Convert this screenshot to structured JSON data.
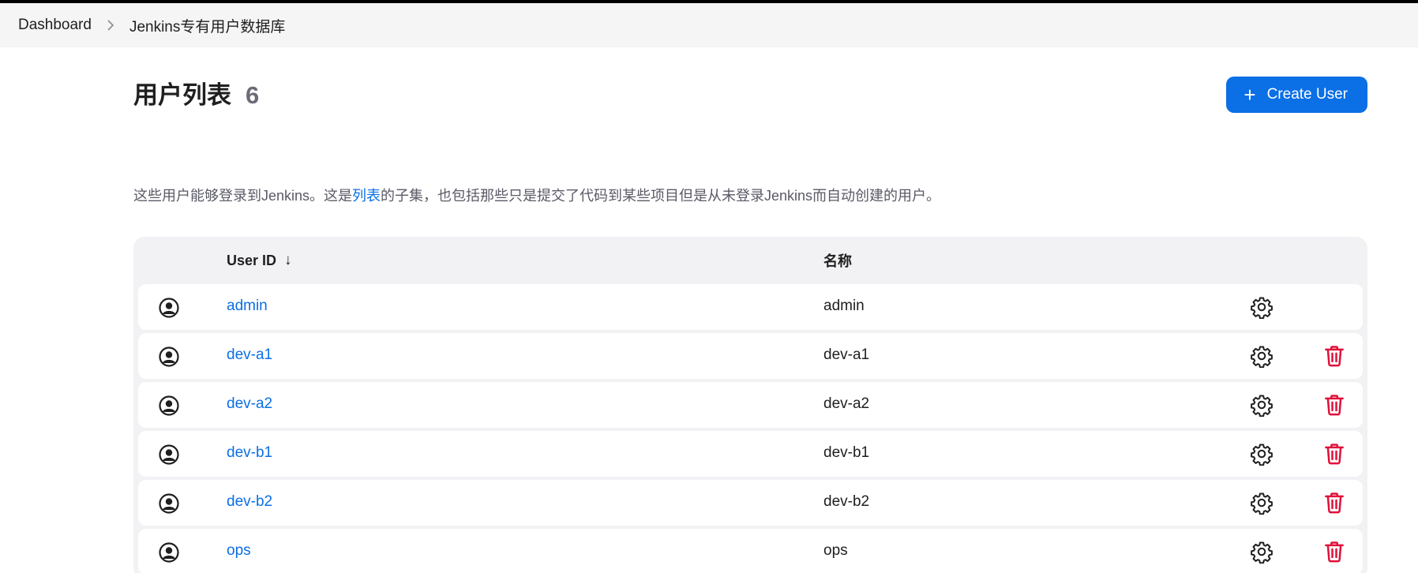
{
  "breadcrumb": {
    "items": [
      {
        "label": "Dashboard"
      },
      {
        "label": "Jenkins专有用户数据库"
      }
    ]
  },
  "header": {
    "title": "用户列表",
    "count": "6",
    "create_button_label": "Create User"
  },
  "description": {
    "before_link": "这些用户能够登录到Jenkins。这是",
    "link_text": "列表",
    "after_link": "的子集，也包括那些只是提交了代码到某些项目但是从未登录Jenkins而自动创建的用户。"
  },
  "table": {
    "columns": {
      "user_id": "User ID",
      "sort_indicator": "↓",
      "name": "名称"
    },
    "rows": [
      {
        "user_id": "admin",
        "name": "admin",
        "deletable": false
      },
      {
        "user_id": "dev-a1",
        "name": "dev-a1",
        "deletable": true
      },
      {
        "user_id": "dev-a2",
        "name": "dev-a2",
        "deletable": true
      },
      {
        "user_id": "dev-b1",
        "name": "dev-b1",
        "deletable": true
      },
      {
        "user_id": "dev-b2",
        "name": "dev-b2",
        "deletable": true
      },
      {
        "user_id": "ops",
        "name": "ops",
        "deletable": true
      }
    ]
  },
  "icons": {
    "avatar": "user-circle-icon",
    "settings": "gear-icon",
    "delete": "trash-icon",
    "separator": "chevron-right-icon",
    "create": "plus-icon"
  },
  "colors": {
    "accent": "#0b6fe6",
    "danger": "#e0103a",
    "breadcrumb_bg": "#f5f5f6",
    "table_bg": "#f2f2f5"
  }
}
